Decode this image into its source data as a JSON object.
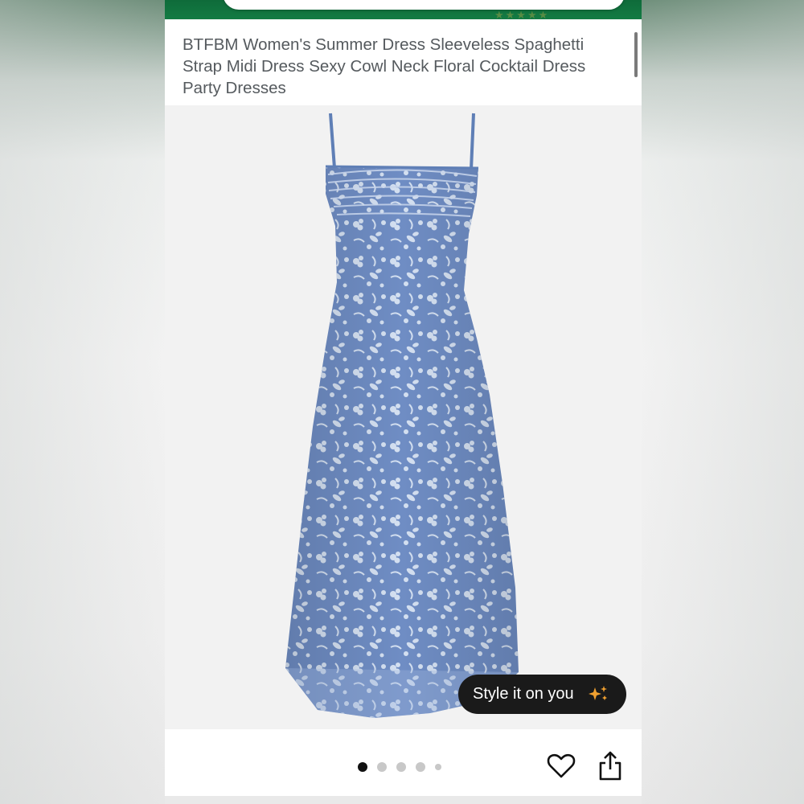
{
  "product": {
    "title": "BTFBM Women's Summer Dress Sleeveless Spaghetti Strap Midi Dress Sexy Cowl Neck Floral Cocktail Dress Party Dresses"
  },
  "image": {
    "subject": "blue floral midi dress",
    "dress_color": "#6f8dc4",
    "pattern_color": "#dfe9f6"
  },
  "style_button": {
    "label": "Style it on you",
    "icon": "sparkle-icon",
    "icon_color": "#f0a030"
  },
  "carousel": {
    "total_dots": 5,
    "active_index": 0
  },
  "actions": {
    "favorite_icon": "heart-icon",
    "share_icon": "share-icon"
  },
  "colors": {
    "header_green": "#137b43",
    "text": "#555a5e",
    "pill_bg": "#1a1a1a"
  }
}
